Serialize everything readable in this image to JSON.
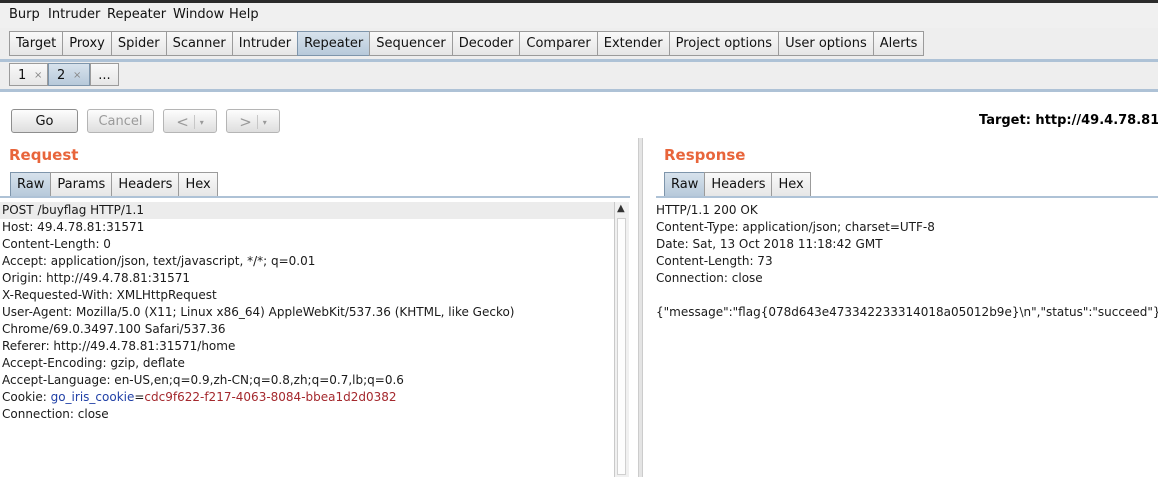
{
  "menubar": [
    "Burp",
    "Intruder",
    "Repeater",
    "Window",
    "Help"
  ],
  "main_tabs": [
    "Target",
    "Proxy",
    "Spider",
    "Scanner",
    "Intruder",
    "Repeater",
    "Sequencer",
    "Decoder",
    "Comparer",
    "Extender",
    "Project options",
    "User options",
    "Alerts"
  ],
  "active_main_tab": "Repeater",
  "sub_tabs": [
    {
      "label": "1",
      "close": "×"
    },
    {
      "label": "2",
      "close": "×"
    },
    {
      "label": "..."
    }
  ],
  "active_sub_tab": "2",
  "toolbar": {
    "go": "Go",
    "cancel": "Cancel",
    "back": "<",
    "forward": ">",
    "dropdown": "▾",
    "target": "Target: http://49.4.78.81"
  },
  "request": {
    "title": "Request",
    "tabs": [
      "Raw",
      "Params",
      "Headers",
      "Hex"
    ],
    "active_tab": "Raw",
    "lines": [
      "POST /buyflag HTTP/1.1",
      "Host: 49.4.78.81:31571",
      "Content-Length: 0",
      "Accept: application/json, text/javascript, */*; q=0.01",
      "Origin: http://49.4.78.81:31571",
      "X-Requested-With: XMLHttpRequest",
      "User-Agent: Mozilla/5.0 (X11; Linux x86_64) AppleWebKit/537.36 (KHTML, like Gecko)",
      "Chrome/69.0.3497.100 Safari/537.36",
      "Referer: http://49.4.78.81:31571/home",
      "Accept-Encoding: gzip, deflate",
      "Accept-Language: en-US,en;q=0.9,zh-CN;q=0.8,zh;q=0.7,lb;q=0.6"
    ],
    "cookie": {
      "prefix": "Cookie: ",
      "name": "go_iris_cookie",
      "eq": "=",
      "value": "cdc9f622-f217-4063-8084-bbea1d2d0382"
    },
    "last_line": "Connection: close"
  },
  "response": {
    "title": "Response",
    "tabs": [
      "Raw",
      "Headers",
      "Hex"
    ],
    "active_tab": "Raw",
    "lines": [
      "HTTP/1.1 200 OK",
      "Content-Type: application/json; charset=UTF-8",
      "Date: Sat, 13 Oct 2018 11:18:42 GMT",
      "Content-Length: 73",
      "Connection: close",
      "",
      "{\"message\":\"flag{078d643e473342233314018a05012b9e}\\n\",\"status\":\"succeed\"}"
    ]
  },
  "icons": {
    "scroll_up": "up-arrow-icon",
    "close": "close-icon"
  },
  "colors": {
    "accent": "#e8653b",
    "active_tab": "#b7c9da",
    "cookie_name": "#1f3fa6",
    "cookie_value": "#a4282d"
  }
}
